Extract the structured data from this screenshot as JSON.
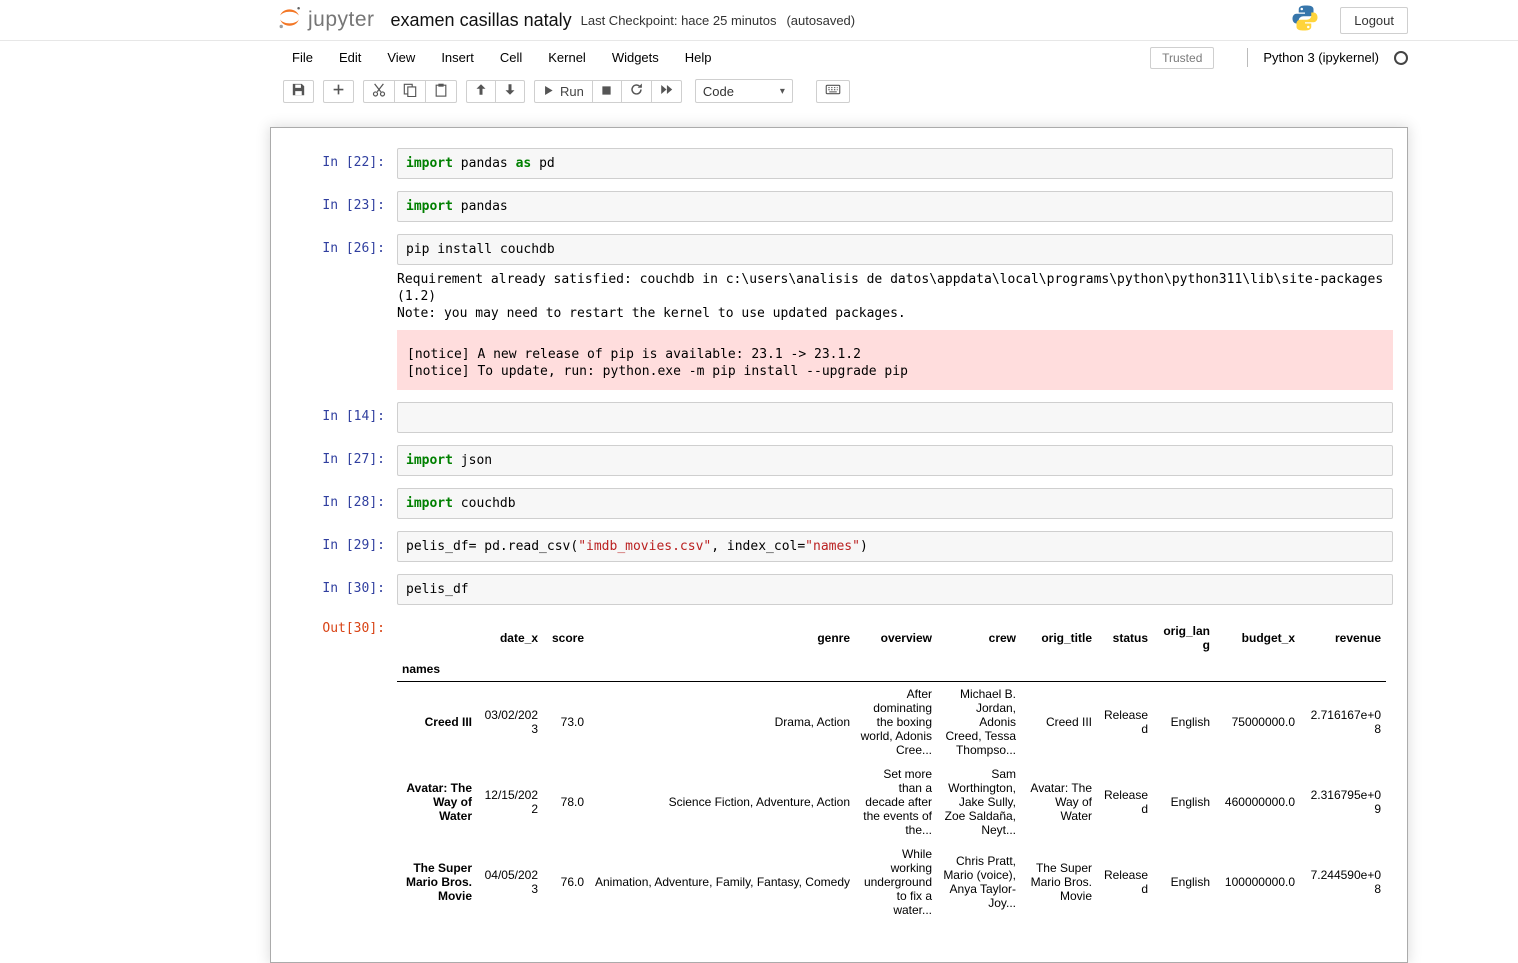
{
  "colors": {
    "jupyter_orange": "#F37726",
    "input_prompt": "#303F9F",
    "output_prompt": "#D84315",
    "code_keyword": "#008000",
    "code_string": "#BA2121",
    "notice_background": "#FFDDDD"
  },
  "header": {
    "logo_text": "jupyter",
    "title": "examen casillas nataly",
    "checkpoint": "Last Checkpoint: hace 25 minutos",
    "autosaved": "(autosaved)",
    "logout_label": "Logout"
  },
  "menubar": {
    "items": [
      "File",
      "Edit",
      "View",
      "Insert",
      "Cell",
      "Kernel",
      "Widgets",
      "Help"
    ],
    "trusted_label": "Trusted",
    "kernel_name": "Python 3 (ipykernel)"
  },
  "toolbar": {
    "run_label": "Run",
    "cell_type_selected": "Code",
    "icons": [
      "save-icon",
      "add-cell-icon",
      "cut-cells-icon",
      "copy-cells-icon",
      "paste-cells-icon",
      "move-cell-up-icon",
      "move-cell-down-icon",
      "run-icon",
      "interrupt-kernel-icon",
      "restart-kernel-icon",
      "restart-run-all-icon",
      "keyboard-icon"
    ]
  },
  "cells": [
    {
      "prompt": "In [22]:",
      "tokens": [
        {
          "c": "kw",
          "t": "import"
        },
        {
          "c": "pl",
          "t": " pandas "
        },
        {
          "c": "kw",
          "t": "as"
        },
        {
          "c": "pl",
          "t": " pd"
        }
      ]
    },
    {
      "prompt": "In [23]:",
      "tokens": [
        {
          "c": "kw",
          "t": "import"
        },
        {
          "c": "pl",
          "t": " pandas"
        }
      ]
    },
    {
      "prompt": "In [26]:",
      "tokens": [
        {
          "c": "pl",
          "t": "pip install couchdb"
        }
      ],
      "output_text": "Requirement already satisfied: couchdb in c:\\users\\analisis de datos\\appdata\\local\\programs\\python\\python311\\lib\\site-packages\n(1.2)\nNote: you may need to restart the kernel to use updated packages.",
      "notice_lines": [
        "[notice] A new release of pip is available: 23.1 -> 23.1.2",
        "[notice] To update, run: python.exe -m pip install --upgrade pip"
      ]
    },
    {
      "prompt": "In [14]:",
      "tokens": []
    },
    {
      "prompt": "In [27]:",
      "tokens": [
        {
          "c": "kw",
          "t": "import"
        },
        {
          "c": "pl",
          "t": " json"
        }
      ]
    },
    {
      "prompt": "In [28]:",
      "tokens": [
        {
          "c": "kw",
          "t": "import"
        },
        {
          "c": "pl",
          "t": " couchdb"
        }
      ]
    },
    {
      "prompt": "In [29]:",
      "tokens": [
        {
          "c": "pl",
          "t": "pelis_df= pd.read_csv("
        },
        {
          "c": "str",
          "t": "\"imdb_movies.csv\""
        },
        {
          "c": "pl",
          "t": ", index_col="
        },
        {
          "c": "str",
          "t": "\"names\""
        },
        {
          "c": "pl",
          "t": ")"
        }
      ]
    },
    {
      "prompt": "In [30]:",
      "tokens": [
        {
          "c": "pl",
          "t": "pelis_df"
        }
      ]
    }
  ],
  "output_table": {
    "prompt": "Out[30]:",
    "index_name": "names",
    "columns": [
      "date_x",
      "score",
      "genre",
      "overview",
      "crew",
      "orig_title",
      "status",
      "orig_lang",
      "budget_x",
      "revenue"
    ],
    "rows": [
      {
        "name": "Creed III",
        "values": [
          "03/02/2023",
          "73.0",
          "Drama, Action",
          "After dominating the boxing world, Adonis Cree...",
          "Michael B. Jordan, Adonis Creed, Tessa Thompso...",
          "Creed III",
          "Released",
          "English",
          "75000000.0",
          "2.716167e+08"
        ]
      },
      {
        "name": "Avatar: The Way of Water",
        "values": [
          "12/15/2022",
          "78.0",
          "Science Fiction, Adventure, Action",
          "Set more than a decade after the events of the...",
          "Sam Worthington, Jake Sully, Zoe Saldaña, Neyt...",
          "Avatar: The Way of Water",
          "Released",
          "English",
          "460000000.0",
          "2.316795e+09"
        ]
      },
      {
        "name": "The Super Mario Bros. Movie",
        "values": [
          "04/05/2023",
          "76.0",
          "Animation, Adventure, Family, Fantasy, Comedy",
          "While working underground to fix a water...",
          "Chris Pratt, Mario (voice), Anya Taylor-Joy...",
          "The Super Mario Bros. Movie",
          "Released",
          "English",
          "100000000.0",
          "7.244590e+08"
        ]
      }
    ]
  }
}
